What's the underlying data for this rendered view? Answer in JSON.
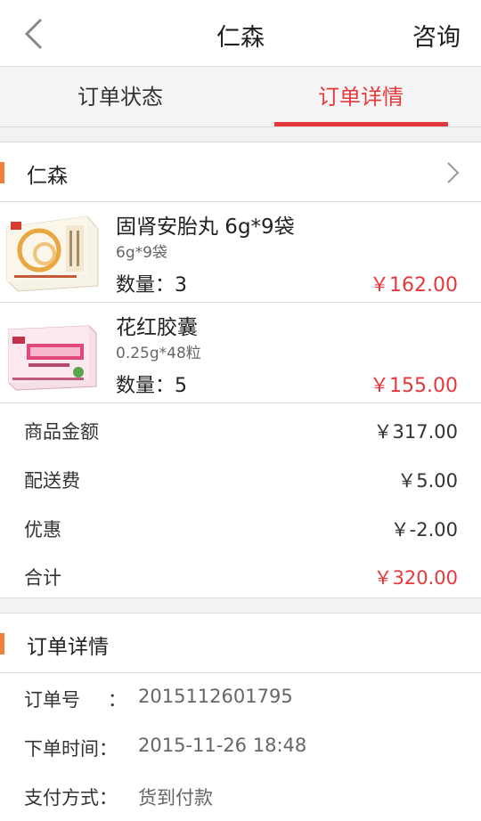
{
  "header": {
    "title": "仁森",
    "consult_label": "咨询"
  },
  "tabs": [
    {
      "label": "订单状态"
    },
    {
      "label": "订单详情"
    }
  ],
  "store": {
    "name": "仁森"
  },
  "products": [
    {
      "name": "固肾安胎丸 6g*9袋",
      "spec": "6g*9袋",
      "quantity": "数量：3",
      "price": "￥162.00"
    },
    {
      "name": "花红胶囊",
      "spec": "0.25g*48粒",
      "quantity": "数量：5",
      "price": "￥155.00"
    }
  ],
  "summary": [
    {
      "label": "商品金额",
      "value": "￥317.00"
    },
    {
      "label": "配送费",
      "value": "￥5.00"
    },
    {
      "label": "优惠",
      "value": "￥-2.00"
    },
    {
      "label": "合计",
      "value": "￥320.00"
    }
  ],
  "details": {
    "title": "订单详情",
    "rows": [
      {
        "label": "订单号",
        "colon": "：",
        "value": "2015112601795"
      },
      {
        "label": "下单时间：",
        "colon": "",
        "value": "2015-11-26 18:48"
      },
      {
        "label": "支付方式：",
        "colon": "",
        "value": "货到付款"
      }
    ]
  },
  "colors": {
    "accent": "#e4393c",
    "section_bar": "#f0803a"
  }
}
